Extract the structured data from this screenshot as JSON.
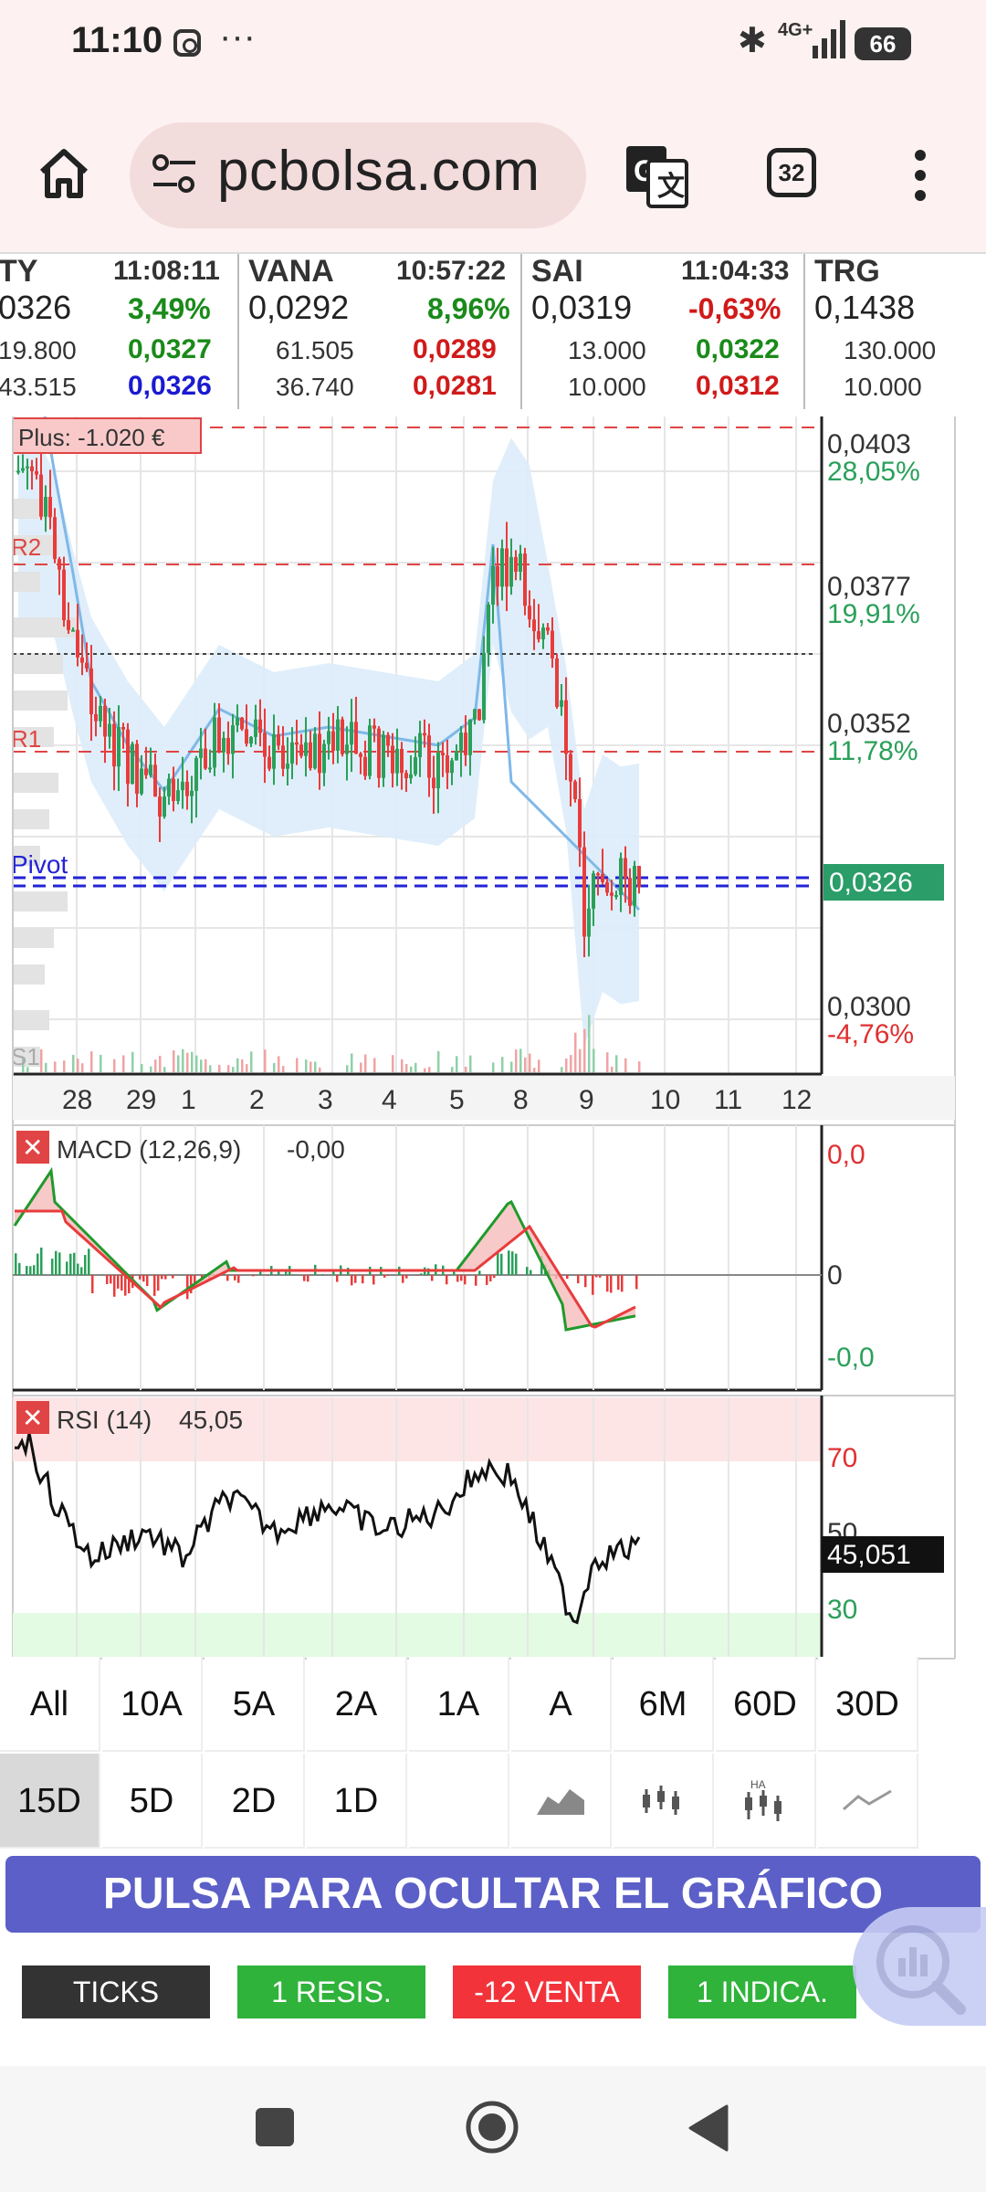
{
  "status_bar": {
    "time": "11:10",
    "more": "···",
    "network": "4G+",
    "battery": "66"
  },
  "browser": {
    "url": "pcbolsa.com",
    "tab_count": "32"
  },
  "ticker": [
    {
      "sym": "TY",
      "time": "11:08:11",
      "price": "0326",
      "pct": "3,49%",
      "pct_color": "#1a8a1a",
      "vol1": "19.800",
      "p1": "0,0327",
      "p1_color": "#1a8a1a",
      "vol2": "43.515",
      "p2": "0,0326",
      "p2_color": "#1a1ad0"
    },
    {
      "sym": "VANA",
      "time": "10:57:22",
      "price": "0,0292",
      "pct": "8,96%",
      "pct_color": "#1a8a1a",
      "vol1": "61.505",
      "p1": "0,0289",
      "p1_color": "#d01a1a",
      "vol2": "36.740",
      "p2": "0,0281",
      "p2_color": "#d01a1a"
    },
    {
      "sym": "SAI",
      "time": "11:04:33",
      "price": "0,0319",
      "pct": "-0,63%",
      "pct_color": "#d01a1a",
      "vol1": "13.000",
      "p1": "0,0322",
      "p1_color": "#1a8a1a",
      "vol2": "10.000",
      "p2": "0,0312",
      "p2_color": "#d01a1a"
    },
    {
      "sym": "TRG",
      "time": "",
      "price": "0,1438",
      "pct": "",
      "pct_color": "#1a1ad0",
      "vol1": "130.000",
      "p1": "",
      "p1_color": "#1a8a1a",
      "vol2": "10.000",
      "p2": "",
      "p2_color": "#d01a1a"
    }
  ],
  "chart": {
    "plus_label": "Plus: -1.020 €",
    "level_labels": {
      "r2": "R2",
      "r1": "R1",
      "pivot": "Pivot",
      "s1": "S1"
    },
    "price_axis": [
      {
        "price": "0,0403",
        "pct": "28,05%",
        "pct_color": "#2aa05a"
      },
      {
        "price": "0,0377",
        "pct": "19,91%",
        "pct_color": "#2aa05a"
      },
      {
        "price": "0,0352",
        "pct": "11,78%",
        "pct_color": "#2aa05a"
      },
      {
        "price": "0,0300",
        "pct": "-4,76%",
        "pct_color": "#e03030"
      }
    ],
    "current_price": "0,0326",
    "x_labels": [
      "28",
      "29",
      "1",
      "2",
      "3",
      "4",
      "5",
      "8",
      "9",
      "10",
      "11",
      "12"
    ],
    "macd": {
      "title": "MACD (12,26,9)",
      "value": "-0,00",
      "axis_top": "0,0",
      "axis_zero": "0",
      "axis_bottom": "-0,0"
    },
    "rsi": {
      "title": "RSI (14)",
      "value": "45,05",
      "axis_70": "70",
      "axis_50": "50",
      "axis_30": "30",
      "current": "45,051"
    },
    "close_icon": "✕"
  },
  "periods_row1": [
    "All",
    "10A",
    "5A",
    "2A",
    "1A",
    "A",
    "6M",
    "60D",
    "30D"
  ],
  "periods_row2": [
    "15D",
    "5D",
    "2D",
    "1D"
  ],
  "chart_types": [
    "area-chart-icon",
    "candlestick-icon",
    "heikin-ashi-icon",
    "line-chart-icon"
  ],
  "hide_chart_label": "PULSA PARA OCULTAR EL GRÁFICO",
  "bottom_buttons": [
    {
      "label": "TICKS",
      "color": "#333333"
    },
    {
      "label": "1 RESIS.",
      "color": "#2fb33a"
    },
    {
      "label": "-12 VENTA",
      "color": "#f2333a"
    },
    {
      "label": "1 INDICA.",
      "color": "#2fb33a"
    }
  ],
  "colors": {
    "up": "#2aa05a",
    "down": "#e83c3c",
    "pivot": "#2323d6",
    "band": "#dcecfa"
  }
}
